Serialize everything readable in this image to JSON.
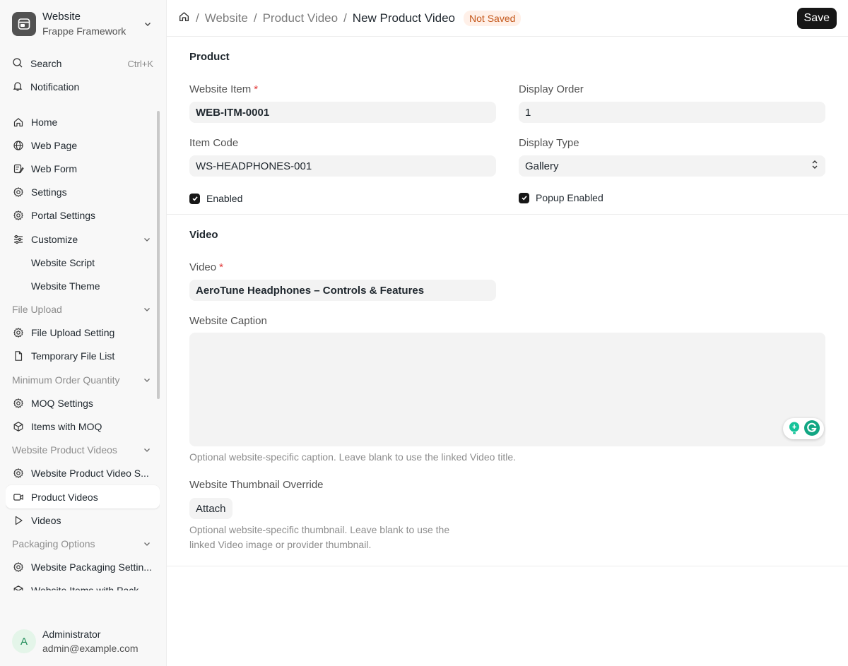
{
  "workspace": {
    "title": "Website",
    "subtitle": "Frappe Framework"
  },
  "utilities": {
    "search_label": "Search",
    "search_shortcut": "Ctrl+K",
    "notification_label": "Notification"
  },
  "sidebar": {
    "items": [
      {
        "label": "Home",
        "icon": "home-icon",
        "kind": "item"
      },
      {
        "label": "Web Page",
        "icon": "globe-icon",
        "kind": "item"
      },
      {
        "label": "Web Form",
        "icon": "form-icon",
        "kind": "item"
      },
      {
        "label": "Settings",
        "icon": "gear-icon",
        "kind": "item"
      },
      {
        "label": "Portal Settings",
        "icon": "gear-icon",
        "kind": "item"
      },
      {
        "label": "Customize",
        "icon": "sliders-icon",
        "kind": "item-expand"
      },
      {
        "label": "Website Script",
        "kind": "sub"
      },
      {
        "label": "Website Theme",
        "kind": "sub"
      },
      {
        "label": "File Upload",
        "kind": "group"
      },
      {
        "label": "File Upload Setting",
        "icon": "gear-icon",
        "kind": "item"
      },
      {
        "label": "Temporary File List",
        "icon": "file-icon",
        "kind": "item"
      },
      {
        "label": "Minimum Order Quantity",
        "kind": "group"
      },
      {
        "label": "MOQ Settings",
        "icon": "gear-icon",
        "kind": "item"
      },
      {
        "label": "Items with MOQ",
        "icon": "box-icon",
        "kind": "item"
      },
      {
        "label": "Website Product Videos",
        "kind": "group"
      },
      {
        "label": "Website Product Video S...",
        "icon": "gear-icon",
        "kind": "item"
      },
      {
        "label": "Product Videos",
        "icon": "video-icon",
        "kind": "item",
        "active": true
      },
      {
        "label": "Videos",
        "icon": "play-icon",
        "kind": "item"
      },
      {
        "label": "Packaging Options",
        "kind": "group"
      },
      {
        "label": "Website Packaging Settin...",
        "icon": "gear-icon",
        "kind": "item"
      },
      {
        "label": "Website Items with Pack...",
        "icon": "box-icon",
        "kind": "item"
      }
    ]
  },
  "user": {
    "initial": "A",
    "name": "Administrator",
    "email": "admin@example.com"
  },
  "header": {
    "crumb_1": "Website",
    "crumb_2": "Product Video",
    "crumb_current": "New Product Video",
    "status": "Not Saved",
    "save_label": "Save"
  },
  "form": {
    "product_section": "Product",
    "website_item_label": "Website Item",
    "website_item_value": "WEB-ITM-0001",
    "display_order_label": "Display Order",
    "display_order_value": "1",
    "item_code_label": "Item Code",
    "item_code_value": "WS-HEADPHONES-001",
    "display_type_label": "Display Type",
    "display_type_value": "Gallery",
    "enabled_label": "Enabled",
    "popup_enabled_label": "Popup Enabled",
    "video_section": "Video",
    "video_label": "Video",
    "video_value": "AeroTune Headphones – Controls & Features",
    "caption_label": "Website Caption",
    "caption_help": "Optional website-specific caption. Leave blank to use the linked Video title.",
    "thumbnail_label": "Website Thumbnail Override",
    "attach_label": "Attach",
    "thumbnail_help_1": "Optional website-specific thumbnail. Leave blank to use the",
    "thumbnail_help_2": "linked Video image or provider thumbnail."
  },
  "colors": {
    "primary": "#171717",
    "badge_bg": "#fff0e8",
    "badge_text": "#c4571a",
    "required": "#e03636",
    "grammarly": "#15c39a"
  }
}
